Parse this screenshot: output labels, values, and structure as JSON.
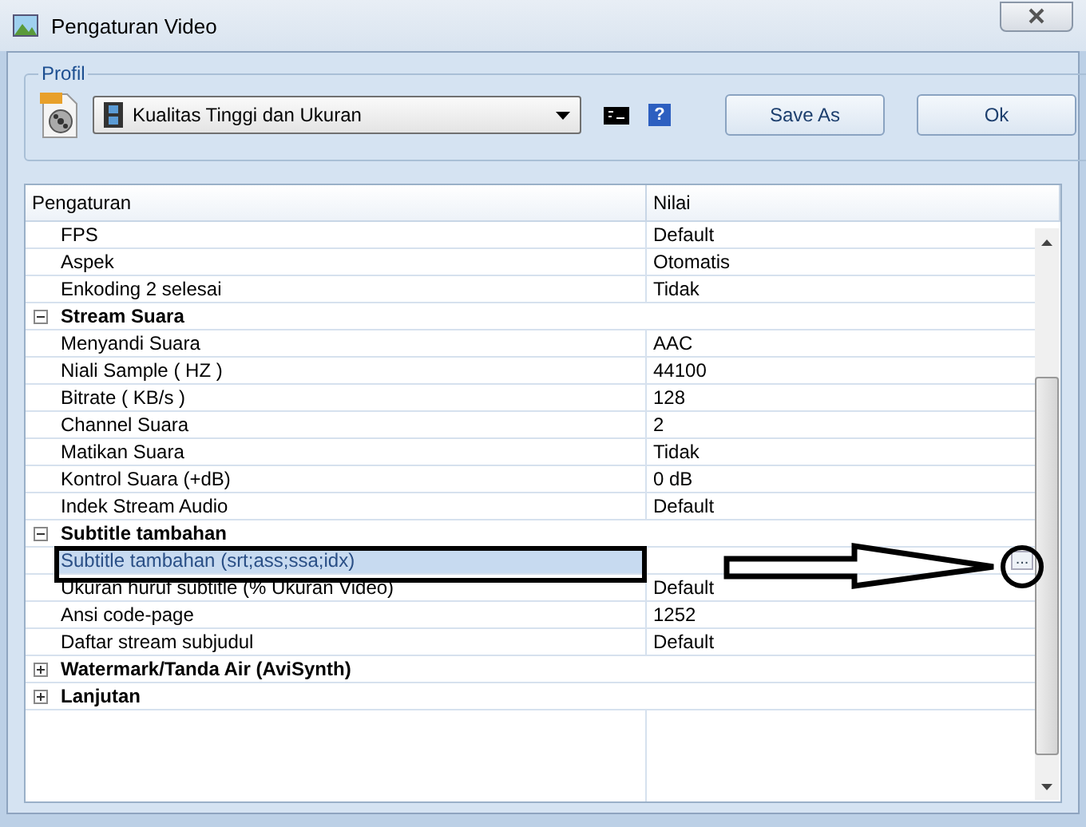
{
  "window": {
    "title": "Pengaturan Video"
  },
  "profile": {
    "legend": "Profil",
    "preset": "Kualitas Tinggi dan Ukuran",
    "buttons": [
      "Save As",
      "Ok"
    ],
    "help": "?"
  },
  "grid": {
    "columns": [
      "Pengaturan",
      "Nilai"
    ],
    "rows": [
      {
        "kind": "property",
        "name": "FPS",
        "value": "Default",
        "selected": false
      },
      {
        "kind": "property",
        "name": "Aspek",
        "value": "Otomatis",
        "selected": false
      },
      {
        "kind": "property",
        "name": "Enkoding 2 selesai",
        "value": "Tidak",
        "selected": false
      },
      {
        "kind": "category",
        "name": "Stream Suara",
        "expanded": true,
        "children": [
          {
            "kind": "property",
            "name": "Menyandi Suara",
            "value": "AAC",
            "selected": false
          },
          {
            "kind": "property",
            "name": "Niali Sample ( HZ )",
            "value": "44100",
            "selected": false
          },
          {
            "kind": "property",
            "name": "Bitrate ( KB/s )",
            "value": "128",
            "selected": false
          },
          {
            "kind": "property",
            "name": "Channel Suara",
            "value": "2",
            "selected": false
          },
          {
            "kind": "property",
            "name": "Matikan Suara",
            "value": "Tidak",
            "selected": false
          },
          {
            "kind": "property",
            "name": "Kontrol Suara (+dB)",
            "value": "0 dB",
            "selected": false
          },
          {
            "kind": "property",
            "name": "Indek Stream Audio",
            "value": "Default",
            "selected": false
          }
        ]
      },
      {
        "kind": "category",
        "name": "Subtitle tambahan",
        "expanded": true,
        "children": [
          {
            "kind": "property",
            "name": "Subtitle tambahan (srt;ass;ssa;idx)",
            "selected": true,
            "button": "..."
          },
          {
            "kind": "property",
            "name": "Ukuran huruf subtitle (% Ukuran Video)",
            "value": "Default",
            "selected": false
          },
          {
            "kind": "property",
            "name": "Ansi code-page",
            "value": "1252",
            "selected": false
          },
          {
            "kind": "property",
            "name": "Daftar stream subjudul",
            "value": "Default",
            "selected": false
          }
        ]
      },
      {
        "kind": "category",
        "name": "Watermark/Tanda Air (AviSynth)",
        "expanded": false,
        "children": []
      },
      {
        "kind": "category",
        "name": "Lanjutan",
        "expanded": false,
        "children": []
      }
    ]
  }
}
